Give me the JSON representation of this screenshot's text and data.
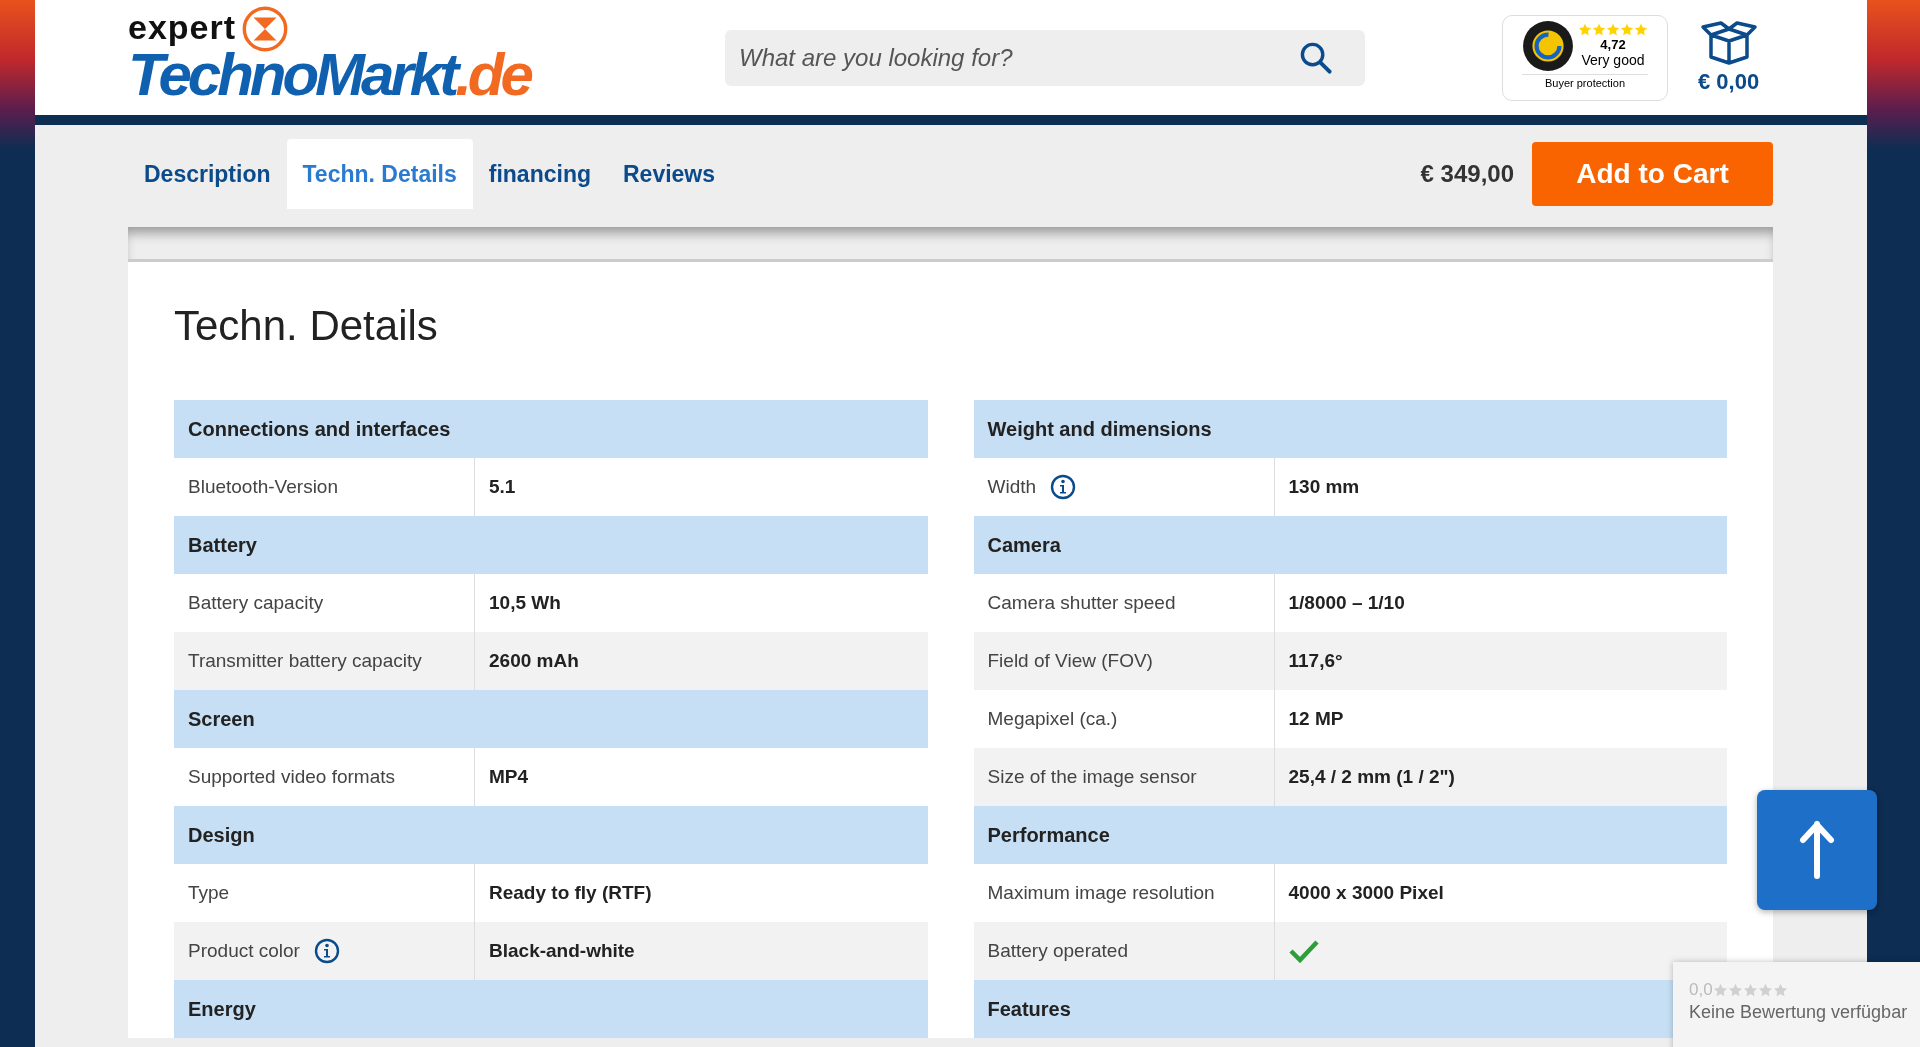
{
  "logo": {
    "top": "expert",
    "main": "TechnoMarkt",
    "tld": ".de"
  },
  "search": {
    "placeholder": "What are you looking for?"
  },
  "trust_badge": {
    "stars": 5,
    "score": "4,72",
    "rating": "Very good",
    "caption": "Buyer protection"
  },
  "cart": {
    "total": "€ 0,00"
  },
  "tabs": [
    {
      "label": "Description",
      "selected": false
    },
    {
      "label": "Techn. Details",
      "selected": true
    },
    {
      "label": "financing",
      "selected": false
    },
    {
      "label": "Reviews",
      "selected": false
    }
  ],
  "price": "€ 349,00",
  "add_to_cart": "Add to Cart",
  "heading": "Techn. Details",
  "tables": [
    {
      "sections": [
        {
          "title": "Connections and interfaces",
          "rows": [
            {
              "label": "Bluetooth-Version",
              "value": "5.1",
              "kind": "text",
              "info": false
            }
          ]
        },
        {
          "title": "Battery",
          "rows": [
            {
              "label": "Battery capacity",
              "value": "10,5 Wh",
              "kind": "text",
              "info": false
            },
            {
              "label": "Transmitter battery capacity",
              "value": "2600 mAh",
              "kind": "text",
              "info": false
            }
          ]
        },
        {
          "title": "Screen",
          "rows": [
            {
              "label": "Supported video formats",
              "value": "MP4",
              "kind": "text",
              "info": false
            }
          ]
        },
        {
          "title": "Design",
          "rows": [
            {
              "label": "Type",
              "value": "Ready to fly (RTF)",
              "kind": "text",
              "info": false
            },
            {
              "label": "Product color",
              "value": "Black-and-white",
              "kind": "text",
              "info": true
            }
          ]
        },
        {
          "title": "Energy"
        }
      ]
    },
    {
      "sections": [
        {
          "title": "Weight and dimensions",
          "rows": [
            {
              "label": "Width",
              "value": "130 mm",
              "kind": "text",
              "info": true
            }
          ]
        },
        {
          "title": "Camera",
          "rows": [
            {
              "label": "Camera shutter speed",
              "value": "1/8000 – 1/10",
              "kind": "text",
              "info": false
            },
            {
              "label": "Field of View (FOV)",
              "value": "117,6°",
              "kind": "text",
              "info": false
            },
            {
              "label": "Megapixel (ca.)",
              "value": "12 MP",
              "kind": "text",
              "info": false
            },
            {
              "label": "Size of the image sensor",
              "value": "25,4 / 2 mm (1 / 2\")",
              "kind": "text",
              "info": false
            }
          ]
        },
        {
          "title": "Performance",
          "rows": [
            {
              "label": "Maximum image resolution",
              "value": "4000 x 3000 Pixel",
              "kind": "text",
              "info": false
            },
            {
              "label": "Battery operated",
              "kind": "check",
              "info": false
            }
          ]
        },
        {
          "title": "Features"
        }
      ]
    }
  ],
  "review_widget": {
    "score": "0,0",
    "stars": 0,
    "text": "Keine Bewertung verfügbar"
  }
}
